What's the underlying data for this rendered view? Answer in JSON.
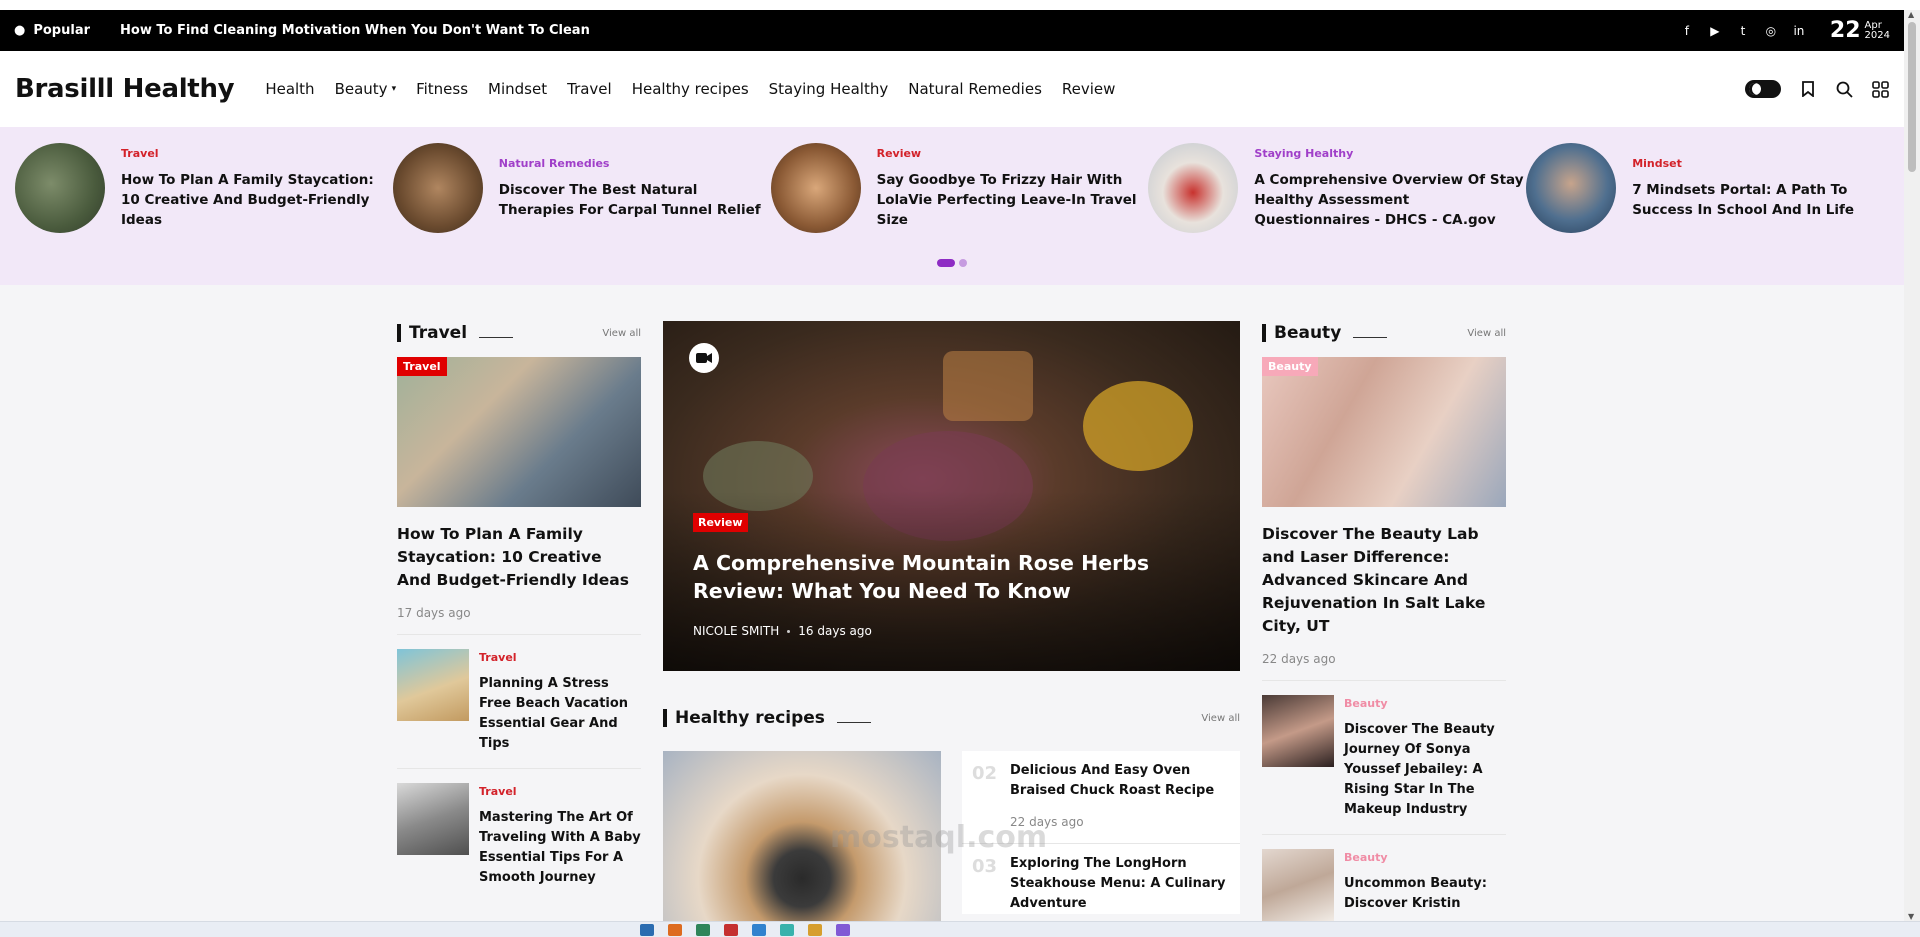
{
  "topbar": {
    "popular_label": "Popular",
    "ticker_text": "How To Find Cleaning Motivation When You Don't Want To Clean",
    "date_day": "22",
    "date_month": "Apr",
    "date_year": "2024"
  },
  "header": {
    "logo": "Brasilll Healthy",
    "nav": [
      "Health",
      "Beauty",
      "Fitness",
      "Mindset",
      "Travel",
      "Healthy recipes",
      "Staying Healthy",
      "Natural Remedies",
      "Review"
    ]
  },
  "carousel": [
    {
      "category": "Travel",
      "category_color": "#d3222a",
      "title": "How To Plan A Family Staycation: 10 Creative And Budget-Friendly Ideas"
    },
    {
      "category": "Natural Remedies",
      "category_color": "#a03fc9",
      "title": "Discover The Best Natural Therapies For Carpal Tunnel Relief"
    },
    {
      "category": "Review",
      "category_color": "#d3222a",
      "title": "Say Goodbye To Frizzy Hair With LolaVie Perfecting Leave-In Travel Size"
    },
    {
      "category": "Staying Healthy",
      "category_color": "#a03fc9",
      "title": "A Comprehensive Overview Of Stay Healthy Assessment Questionnaires - DHCS - CA.gov"
    },
    {
      "category": "Mindset",
      "category_color": "#d3222a",
      "title": "7 Mindsets Portal: A Path To Success In School And In Life"
    }
  ],
  "travel": {
    "heading": "Travel",
    "view_all": "View all",
    "main": {
      "tag": "Travel",
      "title": "How To Plan A Family Staycation: 10 Creative And Budget-Friendly Ideas",
      "time": "17 days ago"
    },
    "items": [
      {
        "category": "Travel",
        "title": "Planning A Stress Free Beach Vacation Essential Gear And Tips"
      },
      {
        "category": "Travel",
        "title": "Mastering The Art Of Traveling With A Baby Essential Tips For A Smooth Journey"
      }
    ]
  },
  "hero": {
    "tag": "Review",
    "title": "A Comprehensive Mountain Rose Herbs Review: What You Need To Know",
    "author": "NICOLE SMITH",
    "time": "16 days ago"
  },
  "healthy_recipes": {
    "heading": "Healthy recipes",
    "view_all": "View all",
    "items": [
      {
        "num": "02",
        "title": "Delicious And Easy Oven Braised Chuck Roast Recipe",
        "time": "22 days ago"
      },
      {
        "num": "03",
        "title": "Exploring The LongHorn Steakhouse Menu: A Culinary Adventure",
        "time": ""
      }
    ]
  },
  "beauty": {
    "heading": "Beauty",
    "view_all": "View all",
    "main": {
      "tag": "Beauty",
      "title": "Discover The Beauty Lab and Laser Difference: Advanced Skincare And Rejuvenation In Salt Lake City, UT",
      "time": "22 days ago"
    },
    "items": [
      {
        "category": "Beauty",
        "title": "Discover The Beauty Journey Of Sonya Youssef Jebailey: A Rising Star In The Makeup Industry"
      },
      {
        "category": "Beauty",
        "title": "Uncommon Beauty: Discover Kristin"
      }
    ]
  },
  "watermark": "mostaql.com",
  "colors": {
    "accent": "#8e2cc4",
    "red_tag": "#e00000",
    "carousel_bg": "#f2e8f8"
  }
}
